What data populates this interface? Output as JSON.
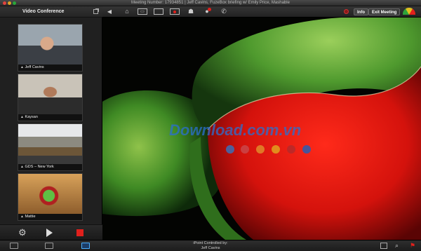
{
  "window": {
    "title": "Meeting Number: 17934851 | Jeff Cavins, FuzeBox briefing w/ Emily Price, Mashable"
  },
  "sidebar": {
    "title": "Video Conference",
    "participants": [
      {
        "name": "Jeff Cavins"
      },
      {
        "name": "Kaysan"
      },
      {
        "name": "GDS – New York"
      },
      {
        "name": "Mattie"
      }
    ]
  },
  "toolbar": {
    "info_label": "Info",
    "exit_label": "Exit Meeting",
    "icons": [
      "collapse-icon",
      "home-icon",
      "image-share-icon",
      "screen-share-icon",
      "record-icon",
      "participants-icon",
      "chat-icon",
      "phone-icon"
    ]
  },
  "main": {
    "watermark": "Download.com.vn",
    "carousel_dot_colors": [
      "#3b6fb6",
      "#c9474a",
      "#e08a2a",
      "#e0a020",
      "#b52a2a",
      "#2a5db0"
    ]
  },
  "bottombar": {
    "presenter_prefix": "iPoint Controlled by:",
    "presenter_name": "Jeff Cavins"
  },
  "colors": {
    "accent_red": "#e0201c",
    "active_blue": "#4ab0ff"
  }
}
